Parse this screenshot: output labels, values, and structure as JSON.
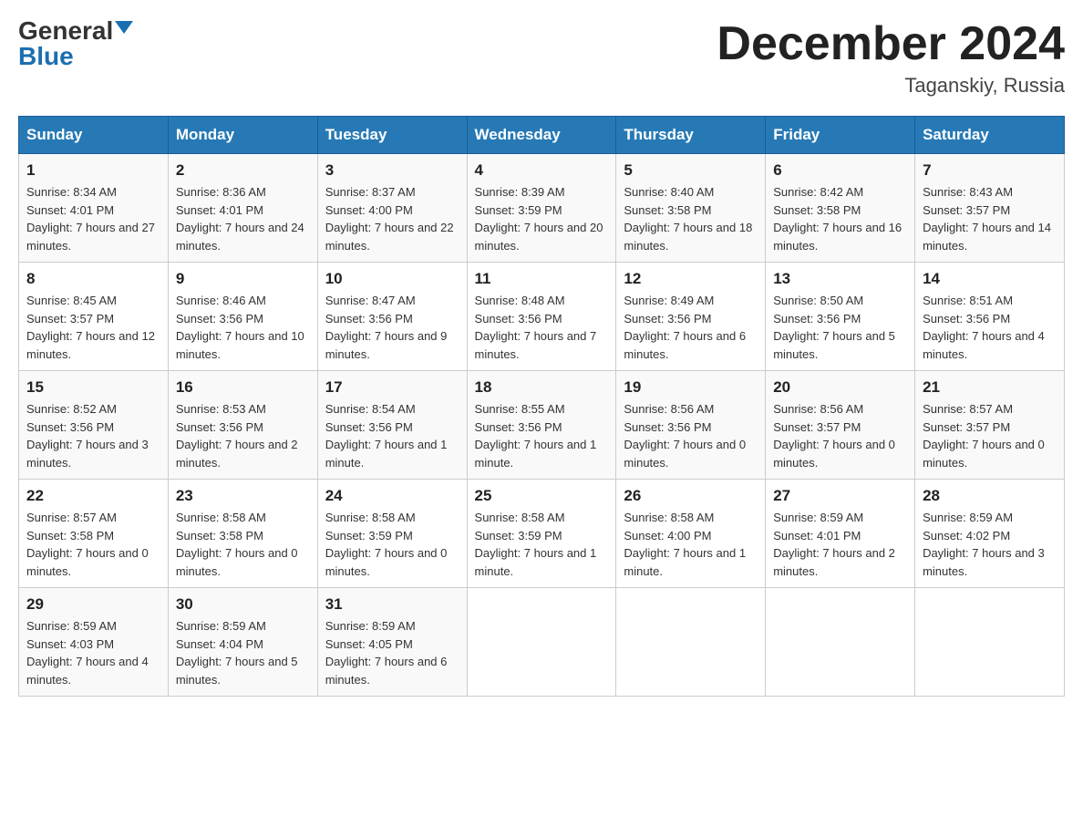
{
  "header": {
    "logo_general": "General",
    "logo_blue": "Blue",
    "month_title": "December 2024",
    "location": "Taganskiy, Russia"
  },
  "weekdays": [
    "Sunday",
    "Monday",
    "Tuesday",
    "Wednesday",
    "Thursday",
    "Friday",
    "Saturday"
  ],
  "weeks": [
    [
      {
        "day": "1",
        "sunrise": "8:34 AM",
        "sunset": "4:01 PM",
        "daylight": "7 hours and 27 minutes."
      },
      {
        "day": "2",
        "sunrise": "8:36 AM",
        "sunset": "4:01 PM",
        "daylight": "7 hours and 24 minutes."
      },
      {
        "day": "3",
        "sunrise": "8:37 AM",
        "sunset": "4:00 PM",
        "daylight": "7 hours and 22 minutes."
      },
      {
        "day": "4",
        "sunrise": "8:39 AM",
        "sunset": "3:59 PM",
        "daylight": "7 hours and 20 minutes."
      },
      {
        "day": "5",
        "sunrise": "8:40 AM",
        "sunset": "3:58 PM",
        "daylight": "7 hours and 18 minutes."
      },
      {
        "day": "6",
        "sunrise": "8:42 AM",
        "sunset": "3:58 PM",
        "daylight": "7 hours and 16 minutes."
      },
      {
        "day": "7",
        "sunrise": "8:43 AM",
        "sunset": "3:57 PM",
        "daylight": "7 hours and 14 minutes."
      }
    ],
    [
      {
        "day": "8",
        "sunrise": "8:45 AM",
        "sunset": "3:57 PM",
        "daylight": "7 hours and 12 minutes."
      },
      {
        "day": "9",
        "sunrise": "8:46 AM",
        "sunset": "3:56 PM",
        "daylight": "7 hours and 10 minutes."
      },
      {
        "day": "10",
        "sunrise": "8:47 AM",
        "sunset": "3:56 PM",
        "daylight": "7 hours and 9 minutes."
      },
      {
        "day": "11",
        "sunrise": "8:48 AM",
        "sunset": "3:56 PM",
        "daylight": "7 hours and 7 minutes."
      },
      {
        "day": "12",
        "sunrise": "8:49 AM",
        "sunset": "3:56 PM",
        "daylight": "7 hours and 6 minutes."
      },
      {
        "day": "13",
        "sunrise": "8:50 AM",
        "sunset": "3:56 PM",
        "daylight": "7 hours and 5 minutes."
      },
      {
        "day": "14",
        "sunrise": "8:51 AM",
        "sunset": "3:56 PM",
        "daylight": "7 hours and 4 minutes."
      }
    ],
    [
      {
        "day": "15",
        "sunrise": "8:52 AM",
        "sunset": "3:56 PM",
        "daylight": "7 hours and 3 minutes."
      },
      {
        "day": "16",
        "sunrise": "8:53 AM",
        "sunset": "3:56 PM",
        "daylight": "7 hours and 2 minutes."
      },
      {
        "day": "17",
        "sunrise": "8:54 AM",
        "sunset": "3:56 PM",
        "daylight": "7 hours and 1 minute."
      },
      {
        "day": "18",
        "sunrise": "8:55 AM",
        "sunset": "3:56 PM",
        "daylight": "7 hours and 1 minute."
      },
      {
        "day": "19",
        "sunrise": "8:56 AM",
        "sunset": "3:56 PM",
        "daylight": "7 hours and 0 minutes."
      },
      {
        "day": "20",
        "sunrise": "8:56 AM",
        "sunset": "3:57 PM",
        "daylight": "7 hours and 0 minutes."
      },
      {
        "day": "21",
        "sunrise": "8:57 AM",
        "sunset": "3:57 PM",
        "daylight": "7 hours and 0 minutes."
      }
    ],
    [
      {
        "day": "22",
        "sunrise": "8:57 AM",
        "sunset": "3:58 PM",
        "daylight": "7 hours and 0 minutes."
      },
      {
        "day": "23",
        "sunrise": "8:58 AM",
        "sunset": "3:58 PM",
        "daylight": "7 hours and 0 minutes."
      },
      {
        "day": "24",
        "sunrise": "8:58 AM",
        "sunset": "3:59 PM",
        "daylight": "7 hours and 0 minutes."
      },
      {
        "day": "25",
        "sunrise": "8:58 AM",
        "sunset": "3:59 PM",
        "daylight": "7 hours and 1 minute."
      },
      {
        "day": "26",
        "sunrise": "8:58 AM",
        "sunset": "4:00 PM",
        "daylight": "7 hours and 1 minute."
      },
      {
        "day": "27",
        "sunrise": "8:59 AM",
        "sunset": "4:01 PM",
        "daylight": "7 hours and 2 minutes."
      },
      {
        "day": "28",
        "sunrise": "8:59 AM",
        "sunset": "4:02 PM",
        "daylight": "7 hours and 3 minutes."
      }
    ],
    [
      {
        "day": "29",
        "sunrise": "8:59 AM",
        "sunset": "4:03 PM",
        "daylight": "7 hours and 4 minutes."
      },
      {
        "day": "30",
        "sunrise": "8:59 AM",
        "sunset": "4:04 PM",
        "daylight": "7 hours and 5 minutes."
      },
      {
        "day": "31",
        "sunrise": "8:59 AM",
        "sunset": "4:05 PM",
        "daylight": "7 hours and 6 minutes."
      },
      null,
      null,
      null,
      null
    ]
  ]
}
